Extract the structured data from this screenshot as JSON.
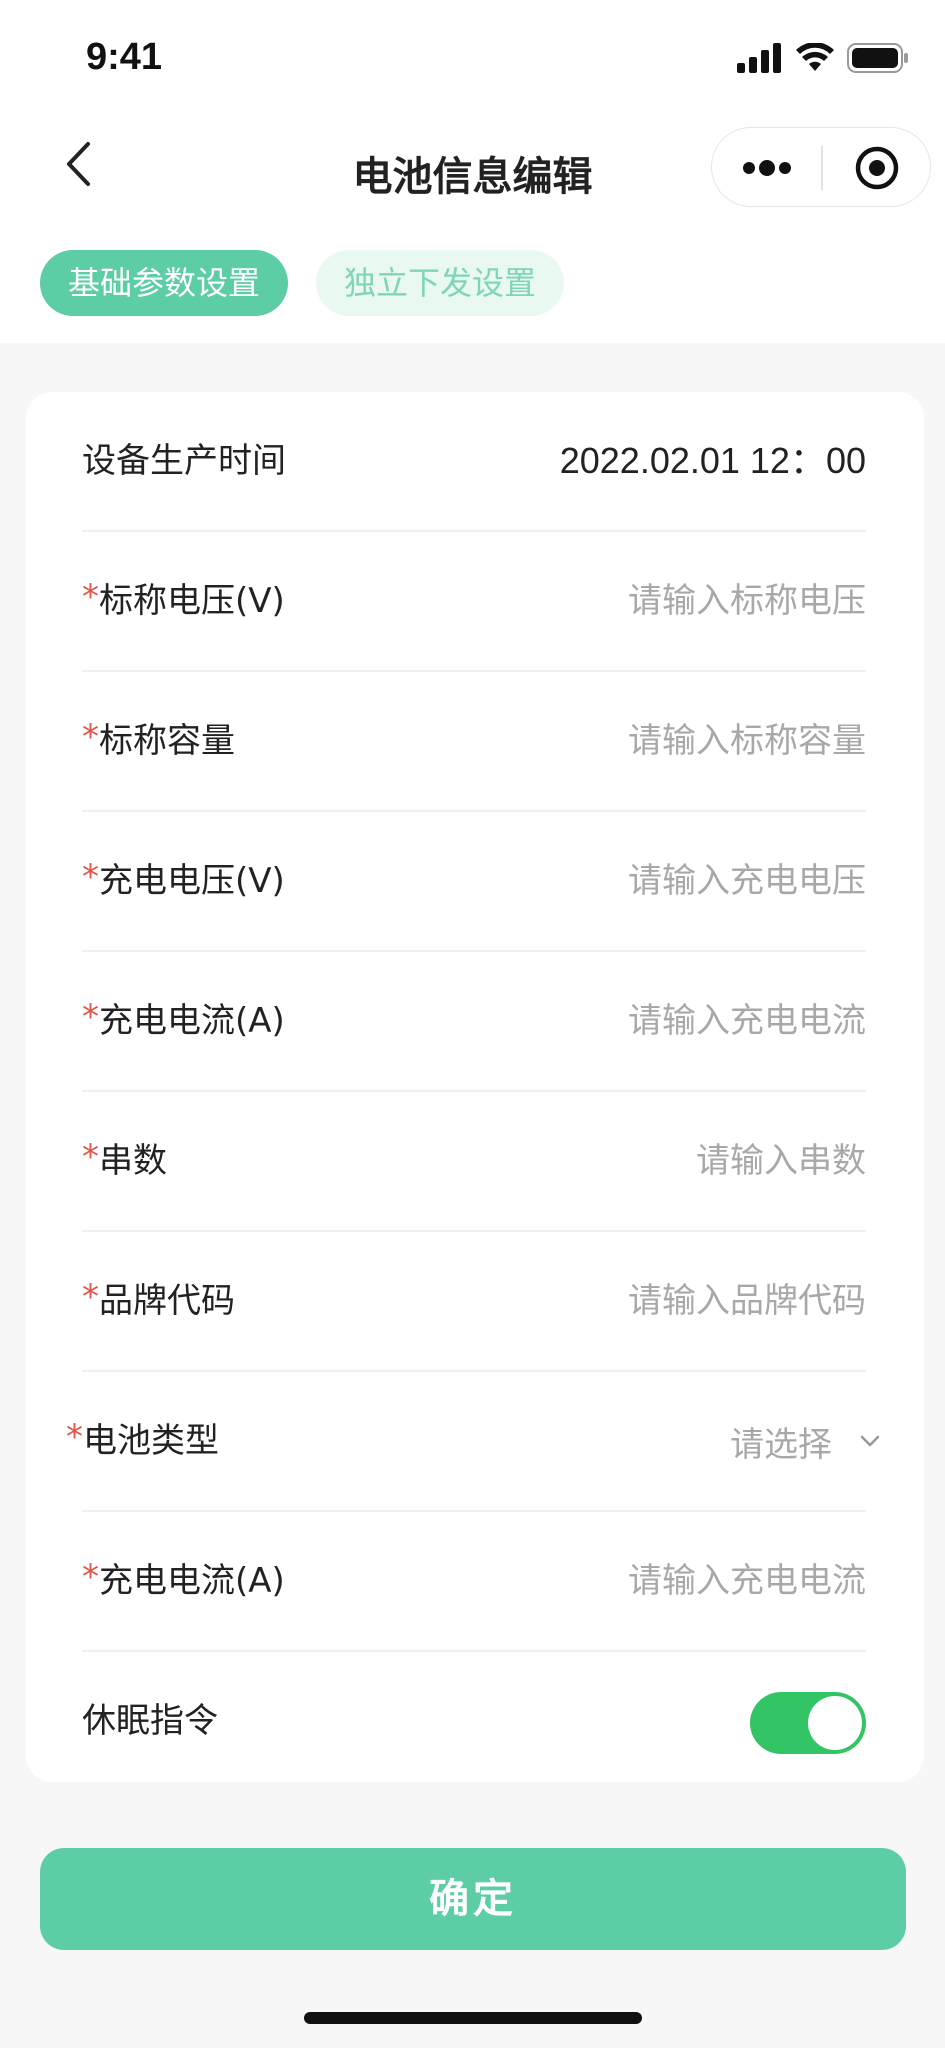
{
  "status_bar": {
    "time": "9:41",
    "icons": [
      "signal-icon",
      "wifi-icon",
      "battery-icon"
    ]
  },
  "nav": {
    "title": "电池信息编辑",
    "back_icon": "chevron-left-icon",
    "more_icon": "more-dots-icon",
    "close_icon": "target-close-icon"
  },
  "tabs": [
    {
      "label": "基础参数设置",
      "active": true
    },
    {
      "label": "独立下发设置",
      "active": false
    }
  ],
  "form": {
    "production_time": {
      "label": "设备生产时间",
      "value": "2022.02.01 12：00"
    },
    "nominal_voltage": {
      "required_mark": "*",
      "label": "标称电压(V)",
      "placeholder": "请输入标称电压"
    },
    "nominal_capacity": {
      "required_mark": "*",
      "label": "标称容量",
      "placeholder": "请输入标称容量"
    },
    "charge_voltage": {
      "required_mark": "*",
      "label": "充电电压(V)",
      "placeholder": "请输入充电电压"
    },
    "charge_current": {
      "required_mark": "*",
      "label": "充电电流(A)",
      "placeholder": "请输入充电电流"
    },
    "series_count": {
      "required_mark": "*",
      "label": "串数",
      "placeholder": "请输入串数"
    },
    "brand_code": {
      "required_mark": "*",
      "label": "品牌代码",
      "placeholder": "请输入品牌代码"
    },
    "battery_type": {
      "required_mark": "*",
      "label": "电池类型",
      "placeholder": "请选择",
      "icon": "chevron-down-icon"
    },
    "charge_current_2": {
      "required_mark": "*",
      "label": "充电电流(A)",
      "placeholder": "请输入充电电流"
    },
    "sleep_command": {
      "label": "休眠指令",
      "enabled": true
    }
  },
  "confirm_label": "确定",
  "colors": {
    "accent": "#5dcda5",
    "toggle_on": "#33c465",
    "required": "#e0574c",
    "placeholder": "#a8a8a8"
  }
}
